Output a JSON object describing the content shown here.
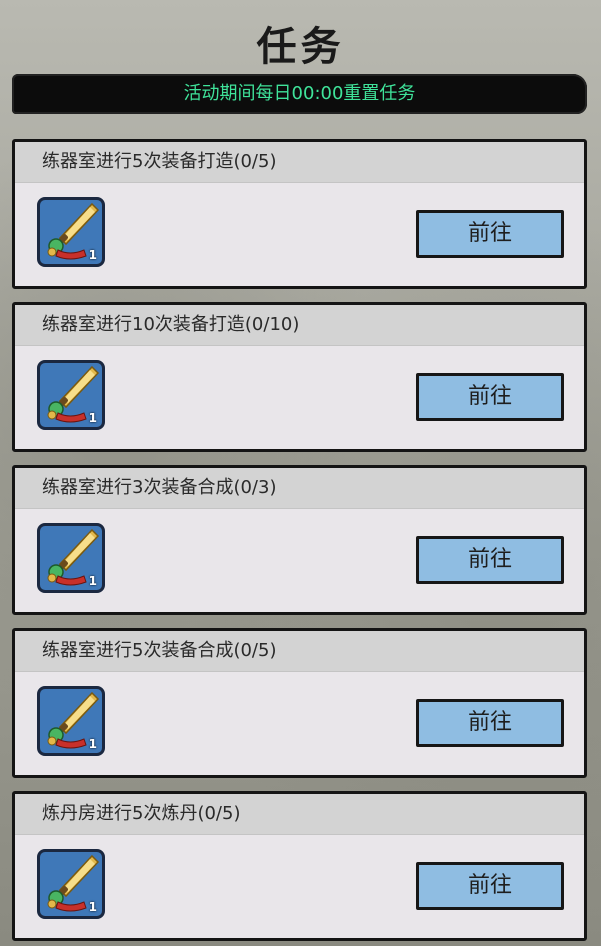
{
  "header": {
    "title": "任务"
  },
  "banner": {
    "text": "活动期间每日00:00重置任务"
  },
  "tasks": [
    {
      "title": "练器室进行5次装备打造(0/5)",
      "item_count": "1",
      "button": "前往",
      "icon": "sword-icon"
    },
    {
      "title": "练器室进行10次装备打造(0/10)",
      "item_count": "1",
      "button": "前往",
      "icon": "sword-icon"
    },
    {
      "title": "练器室进行3次装备合成(0/3)",
      "item_count": "1",
      "button": "前往",
      "icon": "sword-icon"
    },
    {
      "title": "练器室进行5次装备合成(0/5)",
      "item_count": "1",
      "button": "前往",
      "icon": "sword-icon"
    },
    {
      "title": "炼丹房进行5次炼丹(0/5)",
      "item_count": "1",
      "button": "前往",
      "icon": "sword-icon"
    }
  ],
  "colors": {
    "banner_text": "#3fe39a",
    "button_bg": "#8fbde2",
    "icon_bg": "#3f78b8"
  }
}
